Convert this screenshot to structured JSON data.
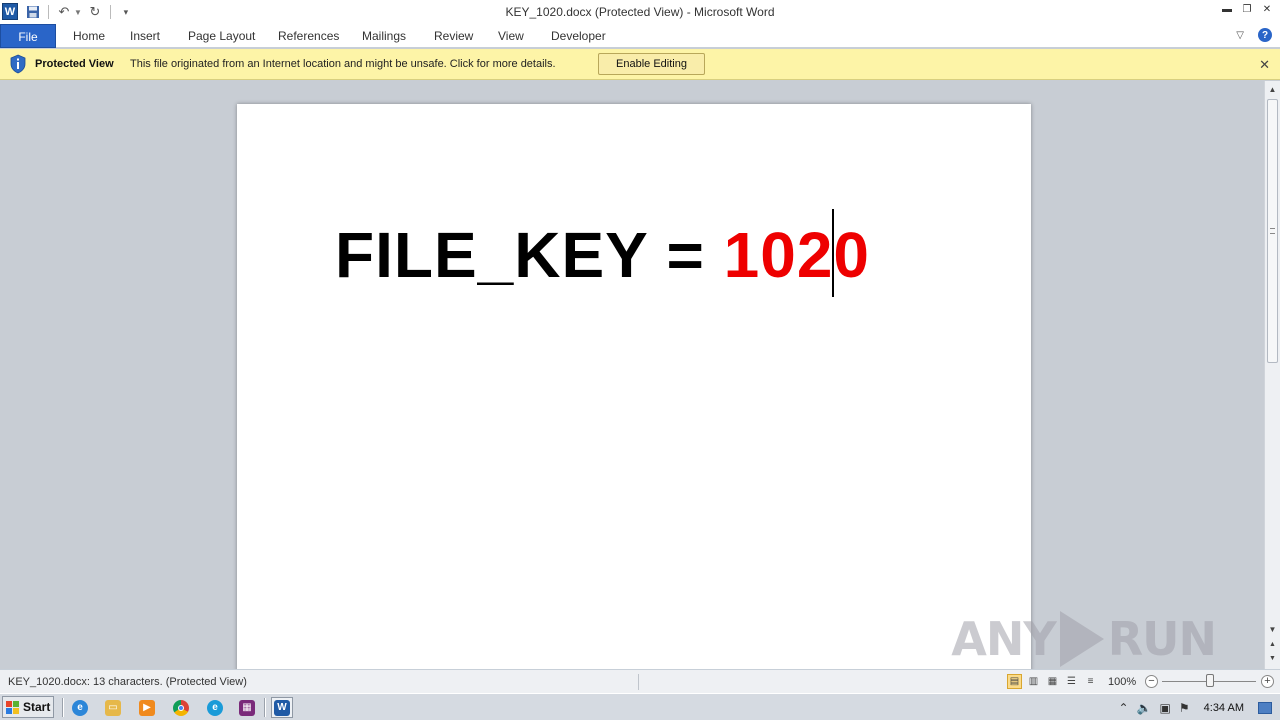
{
  "window": {
    "title": "KEY_1020.docx (Protected View)  -  Microsoft Word",
    "app_icon_letter": "W"
  },
  "ribbon": {
    "tabs": [
      "File",
      "Home",
      "Insert",
      "Page Layout",
      "References",
      "Mailings",
      "Review",
      "View",
      "Developer"
    ]
  },
  "protected_view": {
    "title": "Protected View",
    "message": "This file originated from an Internet location and might be unsafe. Click for more details.",
    "button_label": "Enable Editing",
    "close_glyph": "✕"
  },
  "document": {
    "text_prefix": "FILE_KEY = ",
    "key_part_a": "102",
    "key_part_b": "0",
    "key_color": "#ee0000"
  },
  "watermark": {
    "left": "ANY",
    "right": "RUN"
  },
  "statusbar": {
    "text": "KEY_1020.docx: 13 characters.  (Protected View)",
    "zoom": "100%"
  },
  "taskbar": {
    "start_label": "Start",
    "clock": "4:34 AM"
  },
  "colors": {
    "file_tab": "#2a65c8",
    "protected_bar": "#fdf4a7"
  }
}
